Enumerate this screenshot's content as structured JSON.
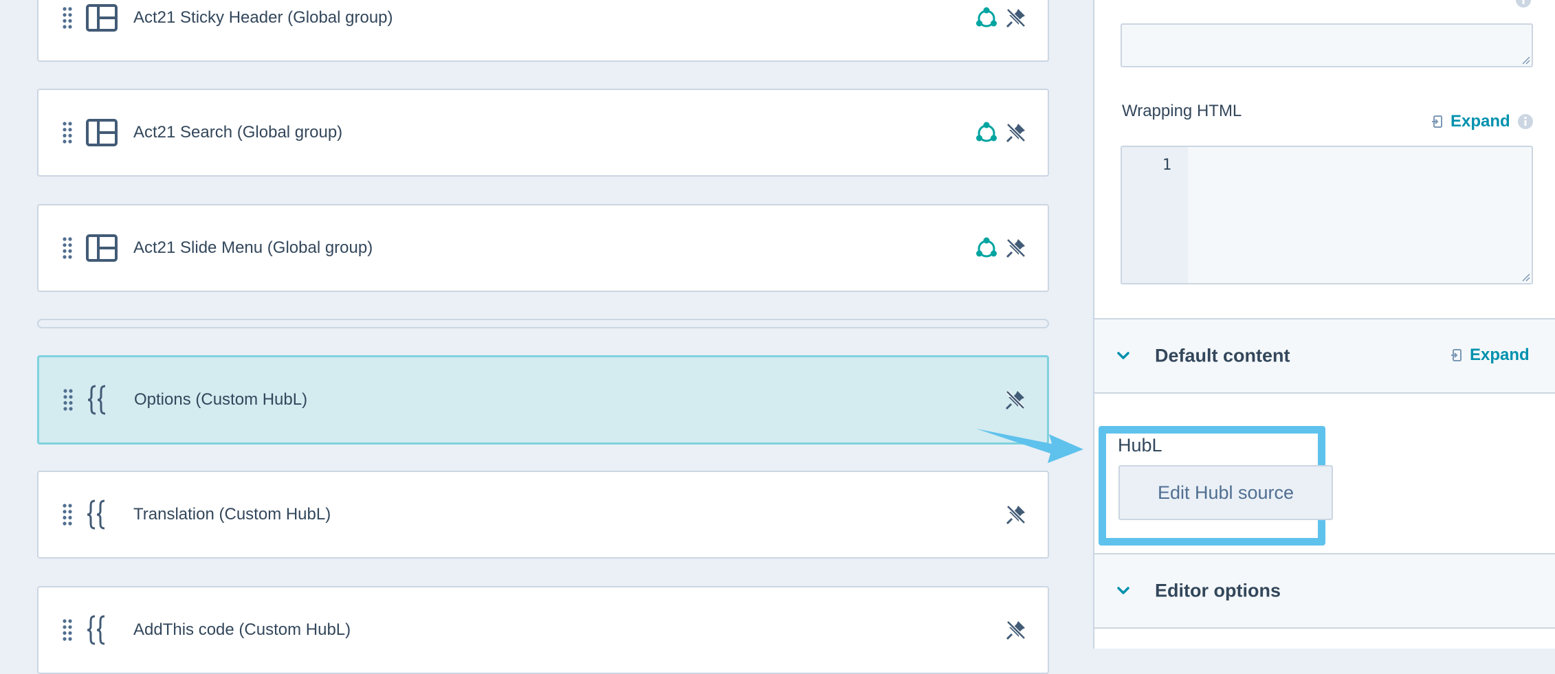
{
  "modules": [
    {
      "label": "Act21 Sticky Header (Global group)",
      "type_icon": "layout-icon",
      "global": true
    },
    {
      "label": "Act21 Search (Global group)",
      "type_icon": "layout-icon",
      "global": true
    },
    {
      "label": "Act21 Slide Menu (Global group)",
      "type_icon": "layout-icon",
      "global": true
    },
    {
      "label": "Options (Custom HubL)",
      "type_icon": "curly-braces-icon",
      "global": false,
      "selected": true
    },
    {
      "label": "Translation (Custom HubL)",
      "type_icon": "curly-braces-icon",
      "global": false
    },
    {
      "label": "AddThis code (Custom HubL)",
      "type_icon": "curly-braces-icon",
      "global": false
    }
  ],
  "sidebar": {
    "wrapping_html": {
      "label": "Wrapping HTML",
      "expand_label": "Expand",
      "line_number": "1"
    },
    "default_content": {
      "title": "Default content",
      "expand_label": "Expand"
    },
    "hubl": {
      "label": "HubL",
      "button_label": "Edit Hubl source"
    },
    "editor_options": {
      "title": "Editor options"
    }
  },
  "colors": {
    "accent": "#0091ae",
    "global_icon": "#00a4a0",
    "highlight_box": "#5ec2ec",
    "selected_row": "#d4ebf0",
    "text": "#33475b",
    "icon": "#425b76"
  }
}
